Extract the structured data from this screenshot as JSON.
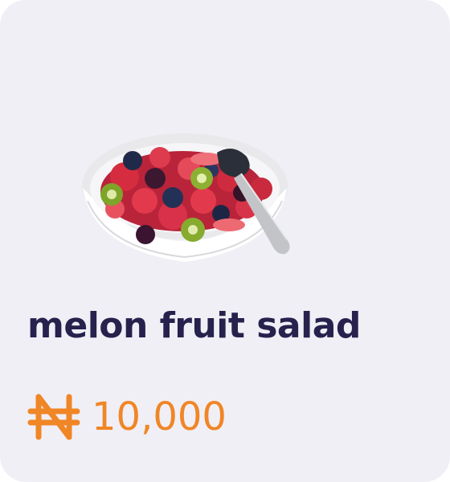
{
  "product": {
    "name": "melon fruit salad",
    "currency_icon": "naira-icon",
    "price": "10,000",
    "image_icon": "fruit-salad-bowl-image"
  },
  "colors": {
    "card_background": "#f0eff6",
    "title": "#27214d",
    "price": "#f08626"
  }
}
